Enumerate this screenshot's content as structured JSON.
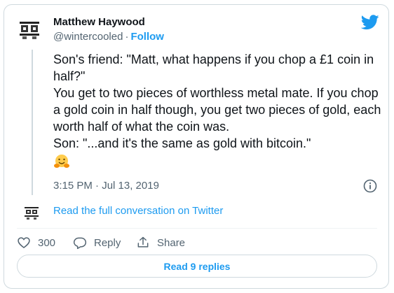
{
  "author": {
    "name": "Matthew Haywood",
    "handle": "@wintercooled",
    "separator": "·",
    "follow_label": "Follow",
    "avatar_icon": "avatar-logo"
  },
  "brand": {
    "icon": "twitter-bird-icon",
    "color": "#1d9bf0"
  },
  "tweet": {
    "lines": [
      "Son's friend: \"Matt, what happens if you chop a £1 coin in half?\"",
      "You get to two pieces of worthless metal mate. If you chop a gold coin in half though, you get two pieces of gold, each worth half of what the coin was.",
      "Son: \"...and it's the same as gold with bitcoin.\""
    ],
    "emoji": "hugging-face-emoji"
  },
  "meta": {
    "timestamp": "3:15 PM · Jul 13, 2019",
    "info_icon": "info-icon"
  },
  "conversation": {
    "link_label": "Read the full conversation on Twitter"
  },
  "actions": {
    "like_count": "300",
    "reply_label": "Reply",
    "share_label": "Share"
  },
  "replies": {
    "button_label": "Read 9 replies"
  },
  "colors": {
    "accent": "#1d9bf0",
    "text": "#0f1419",
    "muted": "#536471",
    "border": "#cfd9de"
  }
}
